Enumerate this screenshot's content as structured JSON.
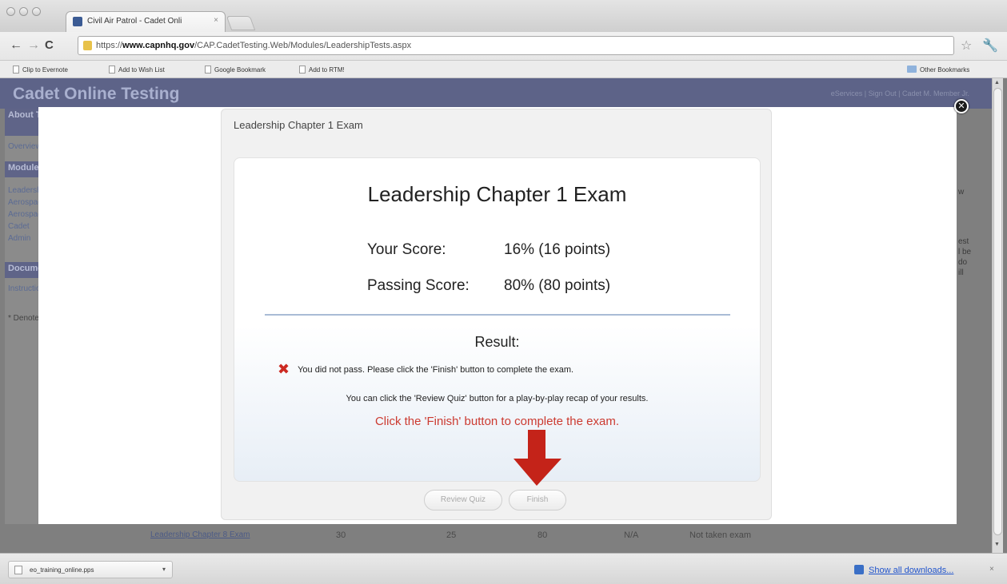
{
  "browser": {
    "tab_title": "Civil Air Patrol - Cadet Onli",
    "tab_close": "×",
    "url_prefix": "https://",
    "url_host": "www.capnhq.gov",
    "url_path": "/CAP.CadetTesting.Web/Modules/LeadershipTests.aspx",
    "bookmarks": [
      "Clip to Evernote",
      "Add to Wish List",
      "Google Bookmark",
      "Add to RTM!"
    ],
    "other_bookmarks": "Other Bookmarks"
  },
  "site": {
    "title": "Cadet Online Testing",
    "header_links": "eServices | Sign Out | Cadet M. Member Jr.",
    "sidebar": {
      "heading_1": "About Tests",
      "links_1": [
        "Overview"
      ],
      "heading_2": "Modules",
      "links_2": [
        "Leadership",
        "Aerospace",
        "Aerospace",
        "Cadet",
        "Admin"
      ],
      "heading_3": "Documents",
      "links_3": [
        "Instructions"
      ],
      "note": "* Denotes"
    },
    "right_fragments": [
      "w",
      "est",
      "l be",
      "do",
      "ill"
    ],
    "bottom_row": [
      "Leadership Chapter 8 Exam",
      "30",
      "25",
      "80",
      "N/A",
      "Not taken exam"
    ]
  },
  "dialog": {
    "title": "Leadership Chapter 1 Exam",
    "exam_title": "Leadership Chapter 1 Exam",
    "your_score_label": "Your Score:",
    "your_score_value": "16% (16 points)",
    "passing_score_label": "Passing Score:",
    "passing_score_value": "80% (80 points)",
    "result_label": "Result:",
    "fail_message": "You did not pass.  Please click the 'Finish' button to complete the exam.",
    "review_message": "You can click the 'Review Quiz' button for a play-by-play recap of your results.",
    "finish_hint": "Click the 'Finish' button to complete the exam.",
    "review_button": "Review Quiz",
    "finish_button": "Finish",
    "close_icon": "close-icon",
    "fail_icon": "x-icon"
  },
  "downloads": {
    "file": "eo_training_online.pps",
    "show_all": "Show all downloads...",
    "close": "×"
  },
  "colors": {
    "header": "#5d6388",
    "hint_red": "#cc3a30",
    "arrow_red": "#c42319",
    "fail_red": "#cc2a22"
  }
}
